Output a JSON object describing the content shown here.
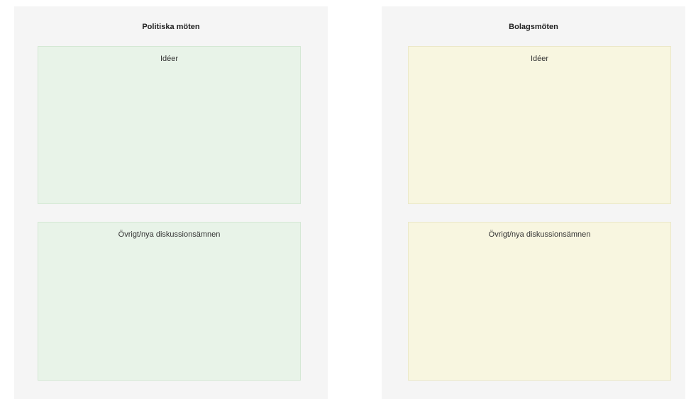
{
  "boards": [
    {
      "title": "Politiska möten",
      "color": "#e8f3e8",
      "sections": [
        {
          "label": "Idéer"
        },
        {
          "label": "Övrigt/nya diskussionsämnen"
        }
      ]
    },
    {
      "title": "Bolagsmöten",
      "color": "#f8f6e0",
      "sections": [
        {
          "label": "Idéer"
        },
        {
          "label": "Övrigt/nya diskussionsämnen"
        }
      ]
    }
  ]
}
